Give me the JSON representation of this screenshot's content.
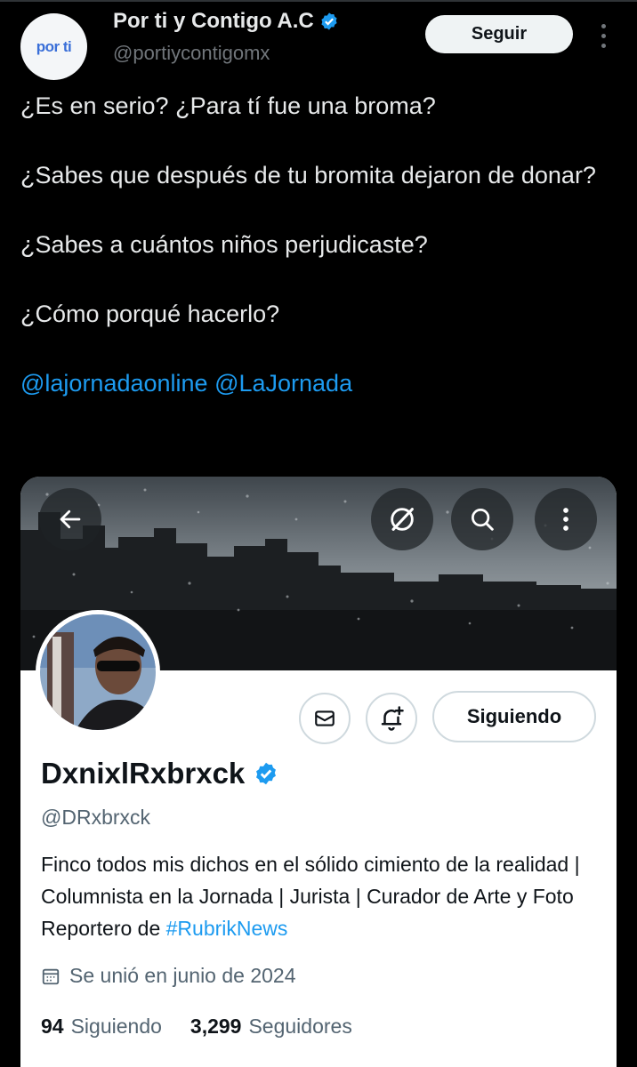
{
  "tweet": {
    "author": {
      "avatar_text": "por ti",
      "name": "Por ti y Contigo A.C",
      "handle": "@portiycontigomx",
      "verified_icon": "verified-badge-icon"
    },
    "follow_label": "Seguir",
    "more_icon": "more-vertical-icon",
    "lines": [
      "¿Es en serio? ¿Para tí fue una broma?",
      "¿Sabes que después de tu bromita dejaron de donar?",
      "¿Sabes a cuántos niños perjudicaste?",
      "¿Cómo porqué hacerlo?"
    ],
    "mentions": [
      "@lajornadaonline",
      "@LaJornada"
    ]
  },
  "profile_card": {
    "back_icon": "back-arrow-icon",
    "grok_icon": "grok-icon",
    "search_icon": "search-icon",
    "more_icon": "more-vertical-icon",
    "message_icon": "envelope-icon",
    "notify_icon": "bell-plus-icon",
    "following_label": "Siguiendo",
    "name": "DxnixlRxbrxck",
    "handle": "@DRxbrxck",
    "bio": "Finco todos mis dichos en el sólido cimiento de la realidad | Columnista en la Jornada | Jurista | Curador de Arte y Foto Reportero de",
    "bio_hashtag": "#RubrikNews",
    "joined": "Se unió en junio de 2024",
    "following_count": "94",
    "following_label_stat": "Siguiendo",
    "followers_count": "3,299",
    "followers_label": "Seguidores"
  },
  "colors": {
    "background": "#000000",
    "accent": "#1d9bf0",
    "text_primary": "#e7e9ea",
    "text_secondary": "#71767b"
  }
}
